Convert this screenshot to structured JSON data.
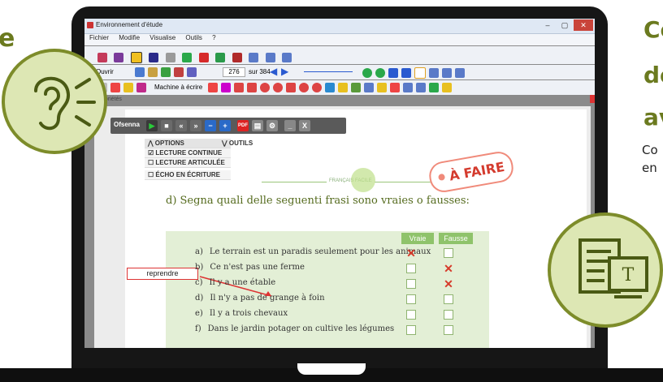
{
  "side_left": {
    "text": "e"
  },
  "side_right": {
    "lines": [
      "Co",
      "de",
      "av"
    ],
    "small": [
      "Co",
      "en"
    ]
  },
  "app": {
    "title": "Environnement d'étude",
    "menu": [
      "Fichier",
      "Modifie",
      "Visualise",
      "Outils",
      "?"
    ],
    "toolbar2": {
      "open_label": "Ouvrir",
      "zoom": "276",
      "page_total": "sur 384"
    },
    "toolbar3": {
      "machine_label": "Machine à écrire"
    },
    "side_tab": "Propriétés"
  },
  "overlay_toolbar": {
    "logo": "Ofsenna",
    "pdf_label": "PDF",
    "close_label": "X"
  },
  "options_panel": {
    "options_label": "OPTIONS",
    "outils_label": "OUTILS",
    "items": [
      {
        "label": "LECTURE CONTINUE",
        "checked": true
      },
      {
        "label": "LECTURE ARTICULÉE",
        "checked": false
      },
      {
        "label": "ÉCHO EN ÉCRITURE",
        "checked": false
      }
    ]
  },
  "page": {
    "center_label": "FRANÇAIS FACILE",
    "badge": "À FAIRE",
    "heading": "d) Segna quali delle seguenti frasi sono vraies o fausses:",
    "col_true": "Vraie",
    "col_false": "Fausse",
    "note": "reprendre",
    "rows": [
      {
        "letter": "a)",
        "text": "Le terrain est un paradis seulement pour les animaux",
        "true_mark": "✕",
        "false_mark": ""
      },
      {
        "letter": "b)",
        "text": "Ce n'est pas une ferme",
        "true_mark": "",
        "false_mark": "✕"
      },
      {
        "letter": "c)",
        "text": "Il y a une étable",
        "true_mark": "",
        "false_mark": "✕"
      },
      {
        "letter": "d)",
        "text": "Il n'y a pas de grange à foin",
        "true_mark": "",
        "false_mark": ""
      },
      {
        "letter": "e)",
        "text": "Il y a trois chevaux",
        "true_mark": "",
        "false_mark": ""
      },
      {
        "letter": "f)",
        "text": "Dans le jardin potager on cultive les légumes",
        "true_mark": "",
        "false_mark": ""
      }
    ]
  },
  "colors": {
    "accent": "#7d8c2a",
    "circle_fill": "#dde7b4",
    "page_green": "#e3efd6",
    "mark_red": "#d63a2a"
  },
  "icons": {
    "left_circle": "ear-sound-icon",
    "right_circle": "document-typing-icon"
  }
}
